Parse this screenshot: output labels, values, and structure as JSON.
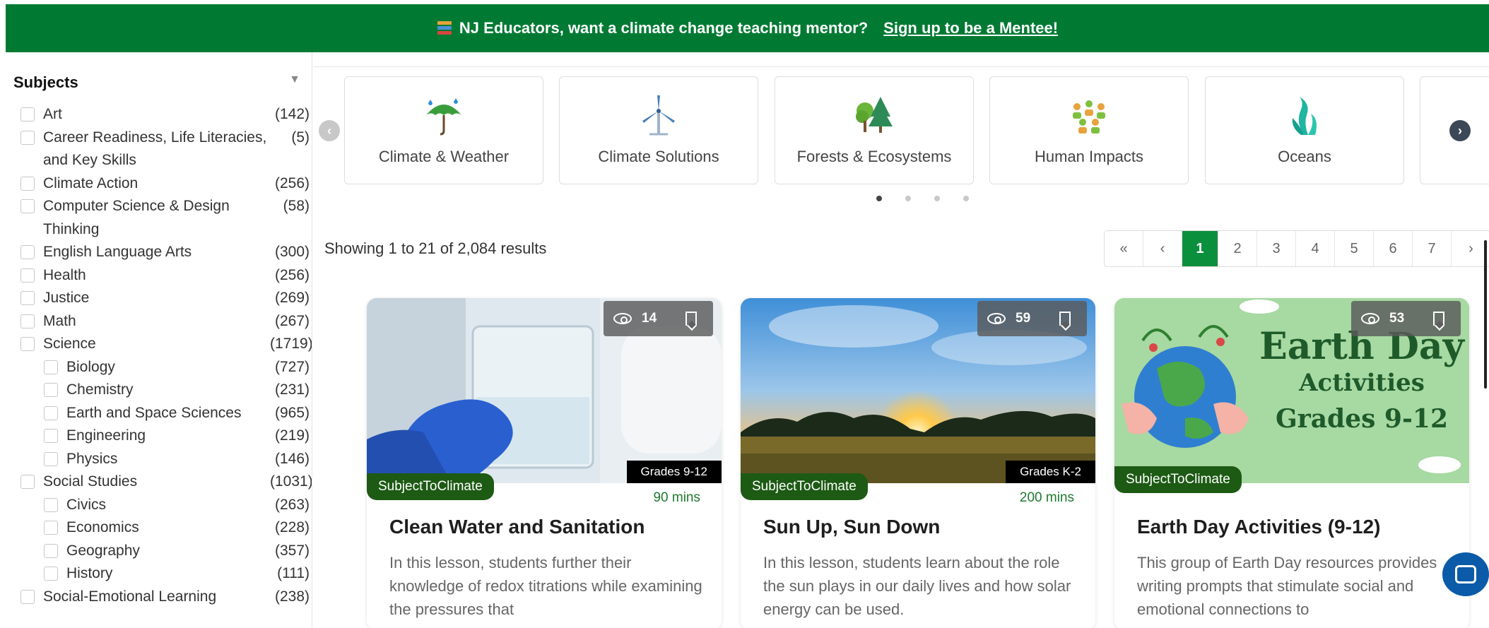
{
  "banner": {
    "text": "NJ Educators, want a climate change teaching mentor?",
    "cta": "Sign up to be a Mentee!",
    "icon": "books-icon",
    "color": "#007a33"
  },
  "sidebar": {
    "title": "Subjects",
    "items": [
      {
        "label": "Art",
        "count": "(142)",
        "level": 0
      },
      {
        "label": "Career Readiness, Life Literacies, and Key Skills",
        "count": "(5)",
        "level": 0
      },
      {
        "label": "Climate Action",
        "count": "(256)",
        "level": 0
      },
      {
        "label": "Computer Science & Design Thinking",
        "count": "(58)",
        "level": 0
      },
      {
        "label": "English Language Arts",
        "count": "(300)",
        "level": 0
      },
      {
        "label": "Health",
        "count": "(256)",
        "level": 0
      },
      {
        "label": "Justice",
        "count": "(269)",
        "level": 0
      },
      {
        "label": "Math",
        "count": "(267)",
        "level": 0
      },
      {
        "label": "Science",
        "count": "(1719)",
        "level": 0
      },
      {
        "label": "Biology",
        "count": "(727)",
        "level": 1
      },
      {
        "label": "Chemistry",
        "count": "(231)",
        "level": 1
      },
      {
        "label": "Earth and Space Sciences",
        "count": "(965)",
        "level": 1
      },
      {
        "label": "Engineering",
        "count": "(219)",
        "level": 1
      },
      {
        "label": "Physics",
        "count": "(146)",
        "level": 1
      },
      {
        "label": "Social Studies",
        "count": "(1031)",
        "level": 0
      },
      {
        "label": "Civics",
        "count": "(263)",
        "level": 1
      },
      {
        "label": "Economics",
        "count": "(228)",
        "level": 1
      },
      {
        "label": "Geography",
        "count": "(357)",
        "level": 1
      },
      {
        "label": "History",
        "count": "(111)",
        "level": 1
      },
      {
        "label": "Social-Emotional Learning",
        "count": "(238)",
        "level": 0
      }
    ]
  },
  "categories": [
    {
      "label": "Climate & Weather",
      "icon": "umbrella-rain-icon"
    },
    {
      "label": "Climate Solutions",
      "icon": "wind-turbine-icon"
    },
    {
      "label": "Forests & Ecosystems",
      "icon": "trees-icon"
    },
    {
      "label": "Human Impacts",
      "icon": "people-icon"
    },
    {
      "label": "Oceans",
      "icon": "seaweed-icon"
    }
  ],
  "results": {
    "text": "Showing 1 to 21 of 2,084 results"
  },
  "pagination": {
    "first": "«",
    "prev": "‹",
    "pages": [
      "1",
      "2",
      "3",
      "4",
      "5",
      "6",
      "7"
    ],
    "next": "›",
    "current": "1"
  },
  "cards": [
    {
      "views": "14",
      "grade": "Grades 9-12",
      "publisher": "SubjectToClimate",
      "duration": "90 mins",
      "title": "Clean Water and Sanitation",
      "description": "In this lesson, students further their knowledge of redox titrations while examining the pressures that"
    },
    {
      "views": "59",
      "grade": "Grades K-2",
      "publisher": "SubjectToClimate",
      "duration": "200 mins",
      "title": "Sun Up, Sun Down",
      "description": "In this lesson, students learn about the role the sun plays in our daily lives and how solar energy can be used."
    },
    {
      "views": "53",
      "grade": "",
      "publisher": "SubjectToClimate",
      "duration": "",
      "title": "Earth Day Activities (9-12)",
      "description": "This group of Earth Day resources provides writing prompts that stimulate social and emotional connections to",
      "image_text": {
        "line1": "Earth Day",
        "line2": "Activities",
        "line3": "Grades 9-12"
      }
    }
  ]
}
